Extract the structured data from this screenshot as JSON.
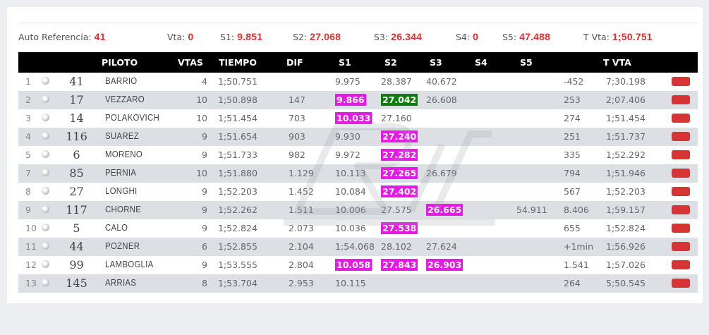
{
  "reference": {
    "auto_label": "Auto Referencia:",
    "auto_value": "41",
    "vta_label": "Vta:",
    "vta_value": "0",
    "s1_label": "S1:",
    "s1_value": "9.851",
    "s2_label": "S2:",
    "s2_value": "27.068",
    "s3_label": "S3:",
    "s3_value": "26.344",
    "s4_label": "S4:",
    "s4_value": "0",
    "s5_label": "S5:",
    "s5_value": "47.488",
    "tvta_label": "T Vta:",
    "tvta_value": "1;50.751"
  },
  "columns": {
    "piloto": "PILOTO",
    "vtas": "VTAS",
    "tiempo": "TIEMPO",
    "dif": "DIF",
    "s1": "S1",
    "s2": "S2",
    "s3": "S3",
    "s4": "S4",
    "s5": "S5",
    "tvta": "T VTA"
  },
  "colors": {
    "highlight_magenta": "#e619e6",
    "highlight_green": "#0e7d0e",
    "action_red": "#d73535"
  },
  "rows": [
    {
      "pos": "1",
      "num": "41",
      "name": "BARRIO",
      "laps": "4",
      "time": "1;50.751",
      "dif": "",
      "s1": "9.975",
      "s2": "28.387",
      "s3": "40.672",
      "s5": "",
      "gap": "-452",
      "tvta": "7;30.198",
      "hl": {}
    },
    {
      "pos": "2",
      "num": "17",
      "name": "VEZZARO",
      "laps": "10",
      "time": "1;50.898",
      "dif": "147",
      "s1": "9.866",
      "s2": "27.042",
      "s3": "26.608",
      "s5": "",
      "gap": "253",
      "tvta": "2;07.406",
      "hl": {
        "s1": "m",
        "s2": "g"
      }
    },
    {
      "pos": "3",
      "num": "14",
      "name": "POLAKOVICH",
      "laps": "10",
      "time": "1;51.454",
      "dif": "703",
      "s1": "10.033",
      "s2": "27.160",
      "s3": "",
      "s5": "",
      "gap": "274",
      "tvta": "1;51.454",
      "hl": {
        "s1": "m"
      }
    },
    {
      "pos": "4",
      "num": "116",
      "name": "SUAREZ",
      "laps": "9",
      "time": "1;51.654",
      "dif": "903",
      "s1": "9.930",
      "s2": "27.240",
      "s3": "",
      "s5": "",
      "gap": "251",
      "tvta": "1;51.737",
      "hl": {
        "s2": "m"
      }
    },
    {
      "pos": "5",
      "num": "6",
      "name": "MORENO",
      "laps": "9",
      "time": "1;51.733",
      "dif": "982",
      "s1": "9.972",
      "s2": "27.282",
      "s3": "",
      "s5": "",
      "gap": "335",
      "tvta": "1;52.292",
      "hl": {
        "s2": "m"
      }
    },
    {
      "pos": "7",
      "num": "85",
      "name": "PERNIA",
      "laps": "10",
      "time": "1;51.880",
      "dif": "1.129",
      "s1": "10.113",
      "s2": "27.265",
      "s3": "26.679",
      "s5": "",
      "gap": "794",
      "tvta": "1;51.946",
      "hl": {
        "s2": "m"
      }
    },
    {
      "pos": "8",
      "num": "27",
      "name": "LONGHI",
      "laps": "9",
      "time": "1;52.203",
      "dif": "1.452",
      "s1": "10.084",
      "s2": "27.402",
      "s3": "",
      "s5": "",
      "gap": "567",
      "tvta": "1;52.203",
      "hl": {
        "s2": "m"
      }
    },
    {
      "pos": "9",
      "num": "117",
      "name": "CHORNE",
      "laps": "9",
      "time": "1;52.262",
      "dif": "1.511",
      "s1": "10.006",
      "s2": "27.575",
      "s3": "26.665",
      "s5": "54.911",
      "gap": "8.406",
      "tvta": "1;59.157",
      "hl": {
        "s3": "m"
      }
    },
    {
      "pos": "10",
      "num": "5",
      "name": "CALO",
      "laps": "9",
      "time": "1;52.824",
      "dif": "2.073",
      "s1": "10.036",
      "s2": "27.538",
      "s3": "",
      "s5": "",
      "gap": "655",
      "tvta": "1;52.824",
      "hl": {
        "s2": "m"
      }
    },
    {
      "pos": "11",
      "num": "44",
      "name": "POZNER",
      "laps": "6",
      "time": "1;52.855",
      "dif": "2.104",
      "s1": "1;54.068",
      "s2": "28.102",
      "s3": "27.624",
      "s5": "",
      "gap": "+1min",
      "tvta": "1;56.926",
      "hl": {}
    },
    {
      "pos": "12",
      "num": "99",
      "name": "LAMBOGLIA",
      "laps": "9",
      "time": "1;53.555",
      "dif": "2.804",
      "s1": "10.058",
      "s2": "27.843",
      "s3": "26.903",
      "s5": "",
      "gap": "1.541",
      "tvta": "1;57.026",
      "hl": {
        "s1": "m",
        "s2": "m",
        "s3": "m"
      }
    },
    {
      "pos": "13",
      "num": "145",
      "name": "ARRIAS",
      "laps": "8",
      "time": "1;53.704",
      "dif": "2.953",
      "s1": "10.115",
      "s2": "",
      "s3": "",
      "s5": "",
      "gap": "264",
      "tvta": "5;50.545",
      "hl": {}
    }
  ]
}
